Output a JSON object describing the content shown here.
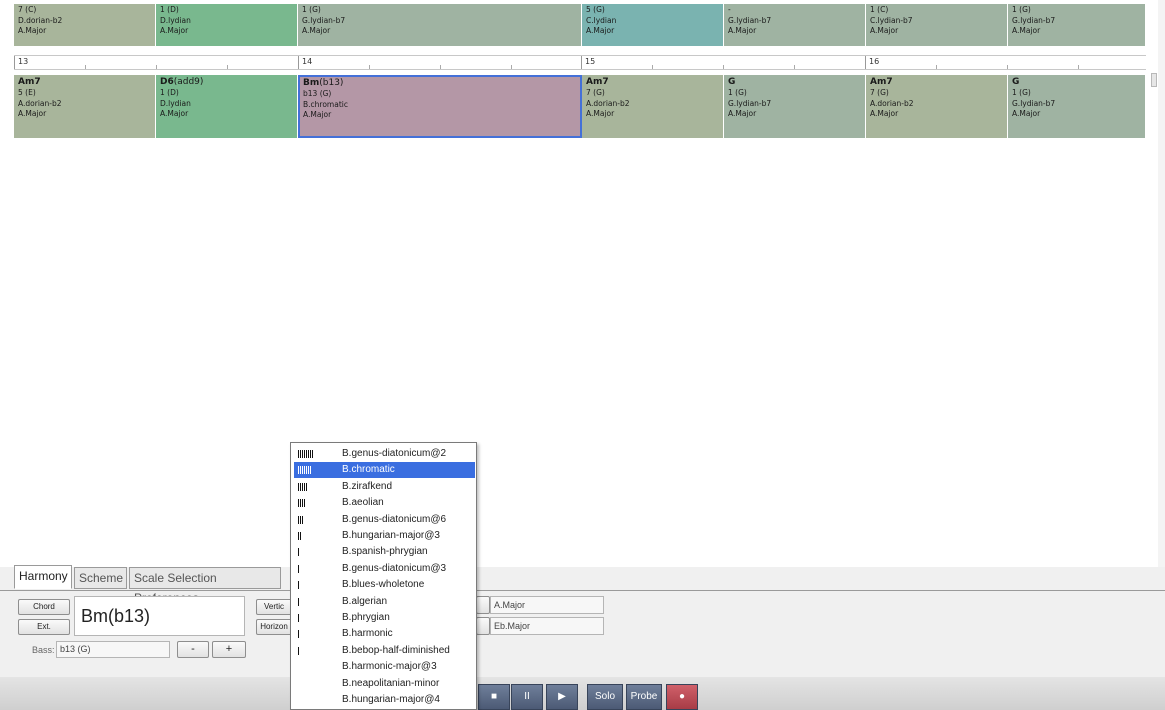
{
  "top_row": [
    {
      "degree": "7 (C)",
      "scale": "D.dorian-b2",
      "key": "A.Major",
      "color": "#a8b59b"
    },
    {
      "degree": "1 (D)",
      "scale": "D.lydian",
      "key": "A.Major",
      "color": "#79b88e"
    },
    {
      "degree": "1 (G)",
      "scale": "G.lydian-b7",
      "key": "A.Major",
      "color": "#9fb3a2"
    },
    {
      "degree": "5 (G)",
      "scale": "C.lydian",
      "key": "A.Major",
      "color": "#7ab3b0"
    },
    {
      "degree": "-",
      "scale": "G.lydian-b7",
      "key": "A.Major",
      "color": "#9fb3a2"
    },
    {
      "degree": "1 (C)",
      "scale": "C.lydian-b7",
      "key": "A.Major",
      "color": "#9fb3a2"
    },
    {
      "degree": "1 (G)",
      "scale": "G.lydian-b7",
      "key": "A.Major",
      "color": "#9fb3a2"
    }
  ],
  "measures": [
    "13",
    "14",
    "15",
    "16"
  ],
  "chord_row": [
    {
      "root": "Am7",
      "ext": "",
      "degree": "5 (E)",
      "scale": "A.dorian-b2",
      "key": "A.Major",
      "color": "#a8b59b"
    },
    {
      "root": "D6",
      "ext": "(add9)",
      "degree": "1 (D)",
      "scale": "D.lydian",
      "key": "A.Major",
      "color": "#79b88e"
    },
    {
      "root": "Bm",
      "ext": "(b13)",
      "degree": "b13 (G)",
      "scale": "B.chromatic",
      "key": "A.Major",
      "color": "#b497a6"
    },
    {
      "root": "Am7",
      "ext": "",
      "degree": "7 (G)",
      "scale": "A.dorian-b2",
      "key": "A.Major",
      "color": "#a8b59b"
    },
    {
      "root": "G",
      "ext": "",
      "degree": "1 (G)",
      "scale": "G.lydian-b7",
      "key": "A.Major",
      "color": "#9fb3a2"
    },
    {
      "root": "Am7",
      "ext": "",
      "degree": "7 (G)",
      "scale": "A.dorian-b2",
      "key": "A.Major",
      "color": "#a8b59b"
    },
    {
      "root": "G",
      "ext": "",
      "degree": "1 (G)",
      "scale": "G.lydian-b7",
      "key": "A.Major",
      "color": "#9fb3a2"
    }
  ],
  "tabs": [
    "Harmony",
    "Scheme",
    "Scale Selection Preferences"
  ],
  "panel": {
    "chord_button": "Chord",
    "ext_button": "Ext.",
    "chord_name": "Bm(b13)",
    "vertical_button": "Vertic",
    "horizontal_button": "Horizon",
    "bass_label": "Bass:",
    "bass_value": "b13 (G)",
    "minus_button": "-",
    "plus_button": "+",
    "key_field": "A.Major",
    "scale_field": "Eb.Major"
  },
  "transport": {
    "stop": "■",
    "pause": "II",
    "play": "▶",
    "solo": "Solo",
    "probe": "Probe",
    "record": "●"
  },
  "scale_dropdown": {
    "selected_index": 1,
    "items": [
      {
        "bars": 8,
        "label": "B.genus-diatonicum@2"
      },
      {
        "bars": 7,
        "label": "B.chromatic"
      },
      {
        "bars": 5,
        "label": "B.zirafkend"
      },
      {
        "bars": 4,
        "label": "B.aeolian"
      },
      {
        "bars": 3,
        "label": "B.genus-diatonicum@6"
      },
      {
        "bars": 2,
        "label": "B.hungarian-major@3"
      },
      {
        "bars": 1,
        "label": "B.spanish-phrygian"
      },
      {
        "bars": 1,
        "label": "B.genus-diatonicum@3"
      },
      {
        "bars": 1,
        "label": "B.blues-wholetone"
      },
      {
        "bars": 1,
        "label": "B.algerian"
      },
      {
        "bars": 1,
        "label": "B.phrygian"
      },
      {
        "bars": 1,
        "label": "B.harmonic"
      },
      {
        "bars": 1,
        "label": "B.bebop-half-diminished"
      },
      {
        "bars": 0,
        "label": "B.harmonic-major@3"
      },
      {
        "bars": 0,
        "label": "B.neapolitanian-minor"
      },
      {
        "bars": 0,
        "label": "B.hungarian-major@4"
      }
    ]
  }
}
